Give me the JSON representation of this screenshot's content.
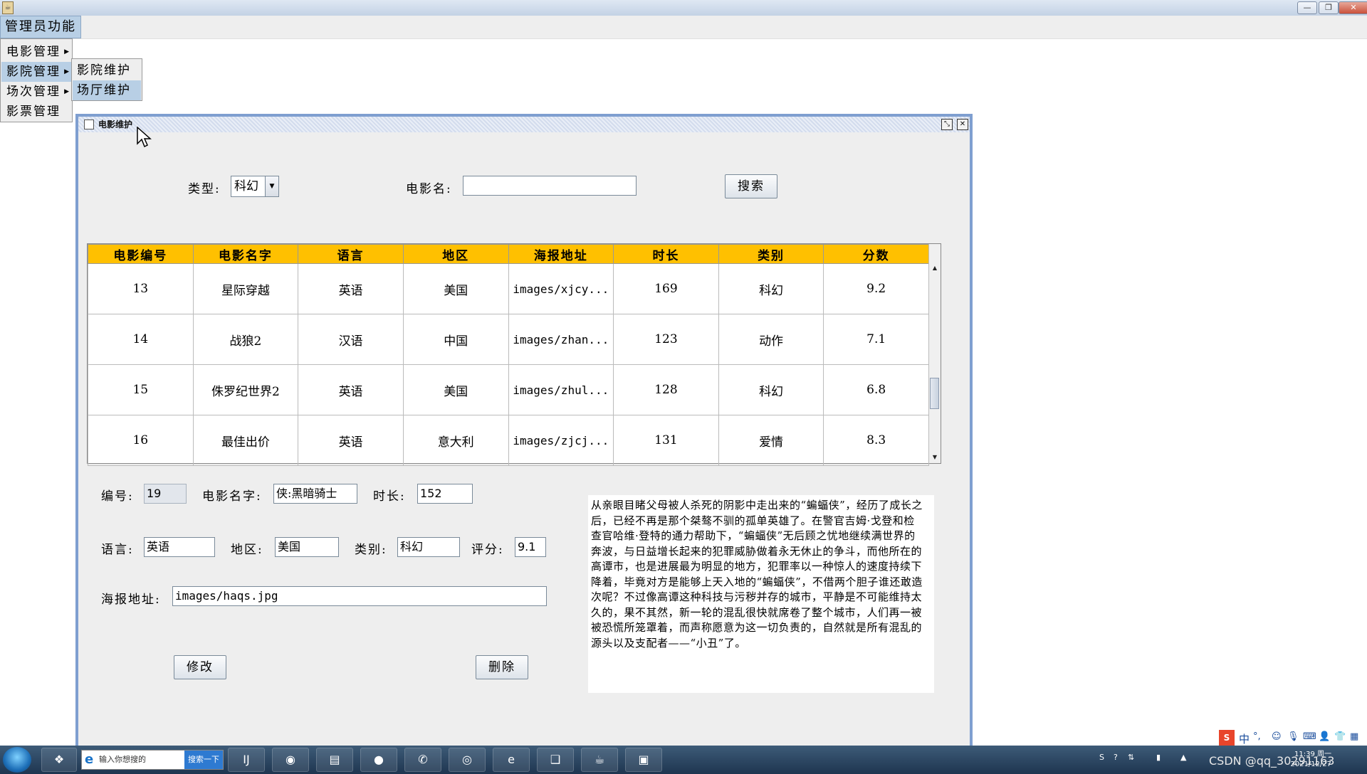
{
  "menubar": {
    "admin_label": "管理员功能"
  },
  "dropdown": {
    "items": [
      {
        "label": "电影管理"
      },
      {
        "label": "影院管理"
      },
      {
        "label": "场次管理"
      },
      {
        "label": "影票管理"
      }
    ],
    "arrow": "▶"
  },
  "submenu": {
    "items": [
      {
        "label": "影院维护"
      },
      {
        "label": "场厅维护"
      }
    ]
  },
  "frame": {
    "title": "电影维护"
  },
  "search": {
    "type_label": "类型:",
    "type_value": "科幻",
    "name_label": "电影名:",
    "name_value": "",
    "button": "搜索"
  },
  "table": {
    "headers": [
      "电影编号",
      "电影名字",
      "语言",
      "地区",
      "海报地址",
      "时长",
      "类别",
      "分数"
    ],
    "rows": [
      [
        "13",
        "星际穿越",
        "英语",
        "美国",
        "images/xjcy...",
        "169",
        "科幻",
        "9.2"
      ],
      [
        "14",
        "战狼2",
        "汉语",
        "中国",
        "images/zhan...",
        "123",
        "动作",
        "7.1"
      ],
      [
        "15",
        "侏罗纪世界2",
        "英语",
        "美国",
        "images/zhul...",
        "128",
        "科幻",
        "6.8"
      ],
      [
        "16",
        "最佳出价",
        "英语",
        "意大利",
        "images/zjcj...",
        "131",
        "爱情",
        "8.3"
      ]
    ]
  },
  "form": {
    "id_label": "编号:",
    "id_value": "19",
    "name_label": "电影名字:",
    "name_value": "侠:黑暗骑士",
    "duration_label": "时长:",
    "duration_value": "152",
    "language_label": "语言:",
    "language_value": "英语",
    "region_label": "地区:",
    "region_value": "美国",
    "category_label": "类别:",
    "category_value": "科幻",
    "score_label": "评分:",
    "score_value": "9.1",
    "poster_label": "海报地址:",
    "poster_value": "images/haqs.jpg",
    "modify_button": "修改",
    "delete_button": "删除"
  },
  "description": "从亲眼目睹父母被人杀死的阴影中走出来的“蝙蝠侠”，经历了成长之后，已经不再是那个桀骜不驯的孤单英雄了。在警官吉姆·戈登和检查官哈维·登特的通力帮助下，“蝙蝠侠”无后顾之忧地继续满世界的奔波，与日益增长起来的犯罪威胁做着永无休止的争斗，而他所在的高谭市，也是进展最为明显的地方，犯罪率以一种惊人的速度持续下降着，毕竟对方是能够上天入地的“蝙蝠侠”，不借两个胆子谁还敢造次呢？不过像高谭这种科技与污秽并存的城市，平静是不可能维持太久的，果不其然，新一轮的混乱很快就席卷了整个城市，人们再一被被恐慌所笼罩着，而声称愿意为这一切负责的，自然就是所有混乱的源头以及支配者——“小丑”了。",
  "taskbar": {
    "search_placeholder": "输入你想搜的",
    "search_button": "搜索一下",
    "tray_text": "CSDN @qq_30291163",
    "clock_time": "11:39 周一",
    "clock_date": "2021/12/27"
  },
  "ime": {
    "label": "中",
    "punct": "°,"
  }
}
